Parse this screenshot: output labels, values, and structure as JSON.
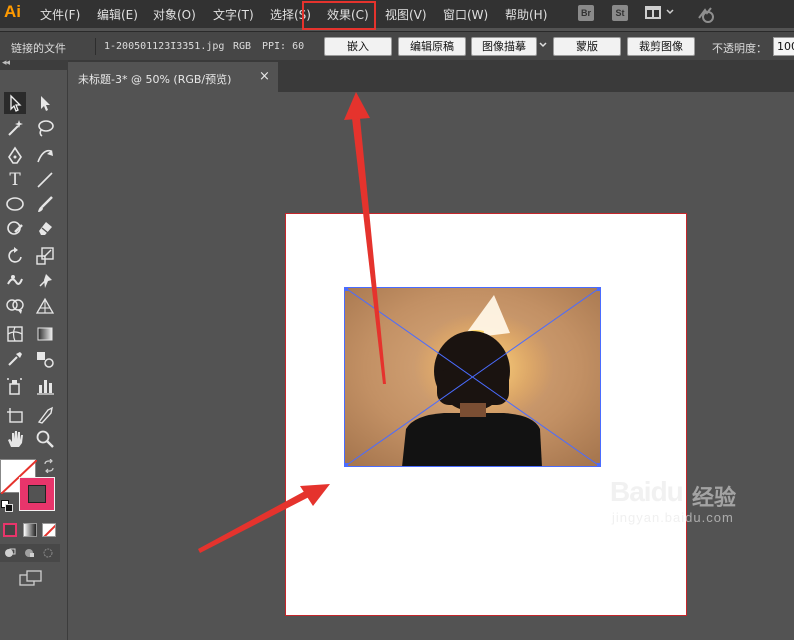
{
  "app": {
    "logo": "Ai"
  },
  "menu": [
    {
      "id": "file",
      "label": "文件(F)"
    },
    {
      "id": "edit",
      "label": "编辑(E)"
    },
    {
      "id": "object",
      "label": "对象(O)"
    },
    {
      "id": "type",
      "label": "文字(T)"
    },
    {
      "id": "select",
      "label": "选择(S)"
    },
    {
      "id": "effect",
      "label": "效果(C)"
    },
    {
      "id": "view",
      "label": "视图(V)"
    },
    {
      "id": "window",
      "label": "窗口(W)"
    },
    {
      "id": "help",
      "label": "帮助(H)"
    }
  ],
  "menubar_right": {
    "bridge": "Br",
    "stock": "St"
  },
  "controlbar": {
    "linked_file_label": "链接的文件",
    "file_name": "1-200501123I3351.jpg",
    "color_mode": "RGB",
    "ppi": "PPI: 60",
    "embed_button": "嵌入",
    "edit_original_button": "编辑原稿",
    "image_trace_button": "图像描摹",
    "mask_button": "蒙版",
    "crop_image_button": "裁剪图像",
    "opacity_label": "不透明度：",
    "opacity_value": "100"
  },
  "document_tab": {
    "title": "未标题-3* @ 50% (RGB/预览)",
    "close": "×"
  },
  "toolbar": {
    "collapse": "◂◂"
  },
  "watermark": {
    "brand": "Baidu",
    "product": "经验",
    "url": "jingyan.baidu.com"
  },
  "colors": {
    "menubar_bg": "#323232",
    "panel_bg": "#535353",
    "accent_orange": "#FF9A00",
    "annotation_red": "#e5332d",
    "selection_blue": "#4a6cff",
    "stroke_swatch": "#e8356b"
  }
}
